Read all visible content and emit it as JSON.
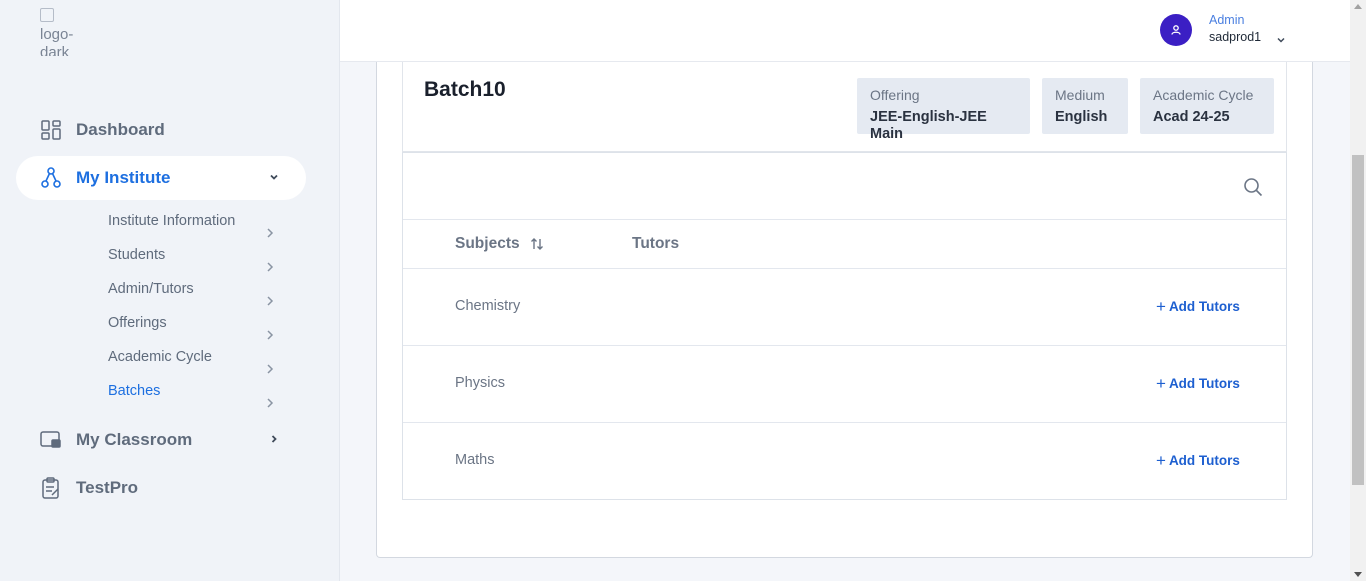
{
  "logo": {
    "alt_text": "logo-dark"
  },
  "sidebar": {
    "items": [
      {
        "label": "Dashboard",
        "icon": "dashboard-grid-icon"
      },
      {
        "label": "My Institute",
        "icon": "org-tree-icon",
        "active": true
      },
      {
        "label": "My Classroom",
        "icon": "classroom-icon"
      },
      {
        "label": "TestPro",
        "icon": "clipboard-icon"
      }
    ],
    "sub_items": [
      {
        "label": "Institute Information"
      },
      {
        "label": "Students"
      },
      {
        "label": "Admin/Tutors"
      },
      {
        "label": "Offerings"
      },
      {
        "label": "Academic Cycle"
      },
      {
        "label": "Batches",
        "active": true
      }
    ]
  },
  "header": {
    "user_role": "Admin",
    "user_name": "sadprod1"
  },
  "batch": {
    "title": "Batch10",
    "chips": [
      {
        "key": "Offering",
        "value": "JEE-English-JEE Main"
      },
      {
        "key": "Medium",
        "value": "English"
      },
      {
        "key": "Academic Cycle",
        "value": "Acad 24-25"
      }
    ]
  },
  "table": {
    "columns": [
      "Subjects",
      "Tutors"
    ],
    "rows": [
      {
        "subject": "Chemistry",
        "action": "Add Tutors"
      },
      {
        "subject": "Physics",
        "action": "Add Tutors"
      },
      {
        "subject": "Maths",
        "action": "Add Tutors"
      }
    ]
  },
  "colors": {
    "accent": "#1d6fe0",
    "avatar": "#3b1fc4",
    "chip_bg": "#e5eaf2"
  }
}
